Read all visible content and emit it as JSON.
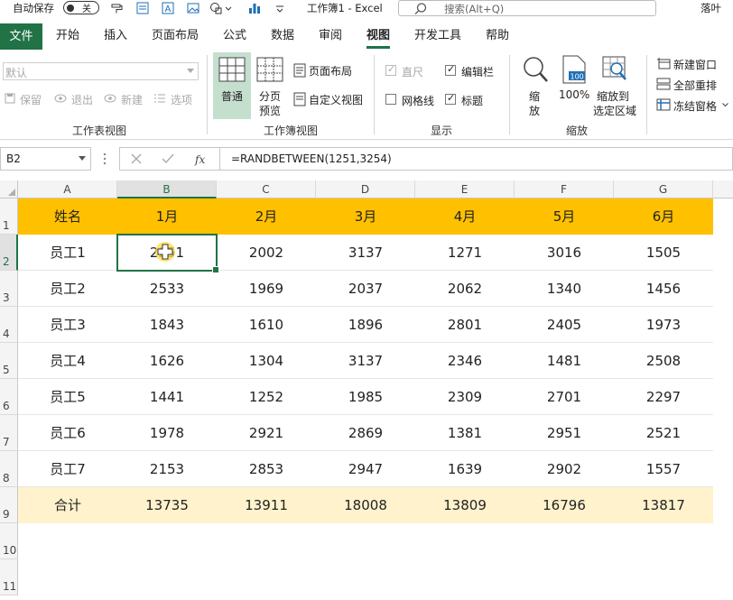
{
  "titlebar": {
    "autosave": "自动保存",
    "toggle": "关",
    "doc_title": "工作簿1 - Excel",
    "search_placeholder": "搜索(Alt+Q)",
    "user": "落叶 "
  },
  "tabs": [
    "文件",
    "开始",
    "插入",
    "页面布局",
    "公式",
    "数据",
    "审阅",
    "视图",
    "开发工具",
    "帮助"
  ],
  "ribbon": {
    "sheet_view": {
      "dropdown": "默认",
      "keep": "保留",
      "exit": "退出",
      "new": "新建",
      "options": "选项",
      "label": "工作表视图"
    },
    "workbook_views": {
      "normal": "普通",
      "page_break_1": "分页",
      "page_break_2": "预览",
      "page_layout": "页面布局",
      "custom_views": "自定义视图",
      "label": "工作簿视图"
    },
    "show": {
      "ruler": "直尺",
      "formula_bar": "编辑栏",
      "gridlines": "网格线",
      "headings": "标题",
      "label": "显示"
    },
    "zoom": {
      "zoom_1": "缩",
      "zoom_2": "放",
      "zoom_100": "100%",
      "to_sel_1": "缩放到",
      "to_sel_2": "选定区域",
      "label": "缩放"
    },
    "window": {
      "new_window": "新建窗口",
      "arrange_all": "全部重排",
      "freeze": "冻结窗格"
    }
  },
  "formula_bar": {
    "name_box": "B2",
    "formula": "=RANDBETWEEN(1251,3254)"
  },
  "sheet": {
    "columns": [
      "A",
      "B",
      "C",
      "D",
      "E",
      "F",
      "G"
    ],
    "rows": [
      "1",
      "2",
      "3",
      "4",
      "5",
      "6",
      "7",
      "8",
      "9",
      "10",
      "11"
    ],
    "header": [
      "姓名",
      "1月",
      "2月",
      "3月",
      "4月",
      "5月",
      "6月"
    ],
    "data": [
      [
        "员工1",
        "2251",
        "2002",
        "3137",
        "1271",
        "3016",
        "1505"
      ],
      [
        "员工2",
        "2533",
        "1969",
        "2037",
        "2062",
        "1340",
        "1456"
      ],
      [
        "员工3",
        "1843",
        "1610",
        "1896",
        "2801",
        "2405",
        "1973"
      ],
      [
        "员工4",
        "1626",
        "1304",
        "3137",
        "2346",
        "1481",
        "2508"
      ],
      [
        "员工5",
        "1441",
        "1252",
        "1985",
        "2309",
        "2701",
        "2297"
      ],
      [
        "员工6",
        "1978",
        "2921",
        "2869",
        "1381",
        "2951",
        "2521"
      ],
      [
        "员工7",
        "2153",
        "2853",
        "2947",
        "1639",
        "2902",
        "1557"
      ]
    ],
    "total": [
      "合计",
      "13735",
      "13911",
      "18008",
      "13809",
      "16796",
      "13817"
    ]
  },
  "colors": {
    "accent": "#217346",
    "header_fill": "#ffc000",
    "total_fill": "#fff2cc"
  }
}
